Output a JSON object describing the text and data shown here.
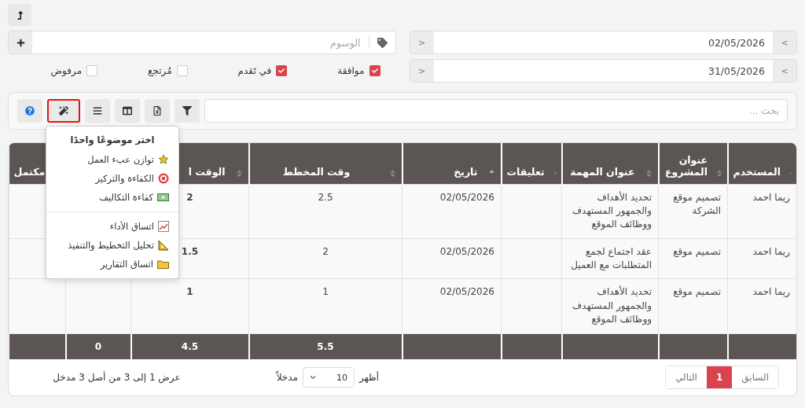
{
  "dates": [
    {
      "value": "02/05/2026",
      "prev": "<",
      "next": ">"
    },
    {
      "value": "31/05/2026",
      "prev": "<",
      "next": ">"
    }
  ],
  "tags_field": {
    "placeholder": "الوسوم"
  },
  "statuses": [
    {
      "label": "موافقة",
      "checked": true
    },
    {
      "label": "في تَقدم",
      "checked": true
    },
    {
      "label": "مُرتجع",
      "checked": false
    },
    {
      "label": "مرفوض",
      "checked": false
    }
  ],
  "toolbar": {
    "search_placeholder": "بحث ...",
    "tools": [
      {
        "highlighted": false
      },
      {
        "highlighted": false
      },
      {
        "highlighted": false
      },
      {
        "highlighted": false
      },
      {
        "highlighted": true
      },
      {
        "highlighted": false
      }
    ]
  },
  "theme_menu": {
    "title": "اختر موضوعًا واحدًا",
    "groups": [
      [
        "توازن عبء العمل",
        "الكفاءة والتركيز",
        "كفاءة التكاليف"
      ],
      [
        "اتساق الأداء",
        "تحليل التخطيط والتنفيذ",
        "اتساق التقارير"
      ]
    ]
  },
  "table": {
    "columns": [
      {
        "label": "المستخدم",
        "sorted": false
      },
      {
        "label": "عنوان المشروع",
        "sorted": false
      },
      {
        "label": "عنوان المهمة",
        "sorted": false
      },
      {
        "label": "تعليقات",
        "sorted": false
      },
      {
        "label": "تاريخ",
        "sorted": true
      },
      {
        "label": "وقت المخطط",
        "sorted": false
      },
      {
        "label": "الوقت ا",
        "sorted": false
      },
      {},
      {
        "label": "مكتمل"
      }
    ],
    "rows": [
      {
        "user": "ريما احمد",
        "project": "تصميم موقع الشركة",
        "task": "تحديد الأهداف والجمهور المستهدف ووظائف الموقع",
        "date": "02/05/2026",
        "planned": "2.5",
        "actual": "2"
      },
      {
        "user": "ريما احمد",
        "project": "تصميم موقع",
        "task": "عقد اجتماع لجمع المتطلبات مع العميل",
        "date": "02/05/2026",
        "planned": "2",
        "actual": "1.5"
      },
      {
        "user": "ريما احمد",
        "project": "تصميم موقع",
        "task": "تحديد الأهداف والجمهور المستهدف ووظائف الموقع",
        "date": "02/05/2026",
        "planned": "1",
        "actual": "1"
      }
    ],
    "totals": {
      "planned": "5.5",
      "actual": "4.5",
      "column_8": "0"
    }
  },
  "page_length": {
    "prefix": "أظهر",
    "value": "10",
    "suffix": "مدخلاً"
  },
  "info": "عرض 1 إلى 3 من أصل 3 مدخل",
  "pagination": {
    "previous": "السابق",
    "pages": [
      {
        "label": "1",
        "selected": true
      }
    ],
    "next": "التالي"
  }
}
